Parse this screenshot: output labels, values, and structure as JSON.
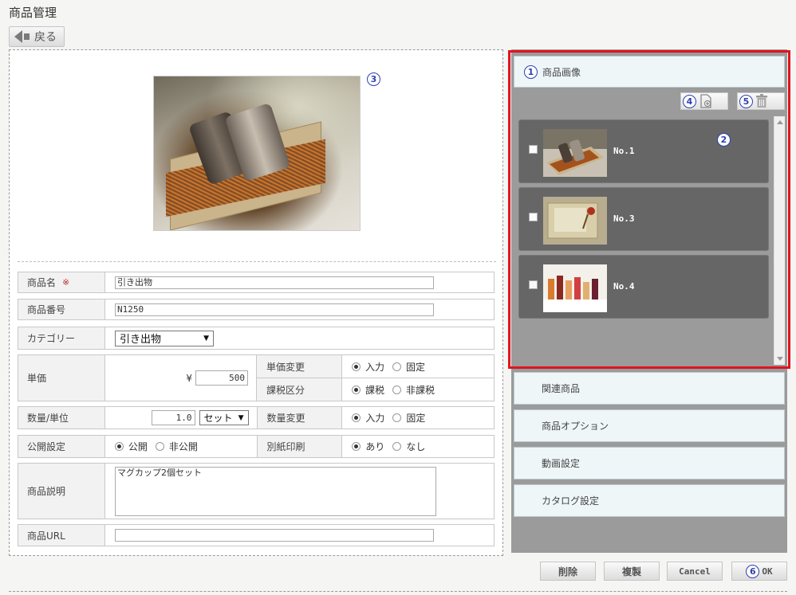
{
  "page": {
    "title": "商品管理",
    "back_label": "戻る"
  },
  "markers": {
    "m1": "1",
    "m2": "2",
    "m3": "3",
    "m4": "4",
    "m5": "5",
    "m6": "6"
  },
  "form": {
    "name_label": "商品名",
    "required_mark": "※",
    "name_value": "引き出物",
    "number_label": "商品番号",
    "number_value": "N1250",
    "category_label": "カテゴリー",
    "category_value": "引き出物",
    "price_label": "単価",
    "price_currency": "¥",
    "price_value": "500",
    "price_change_label": "単価変更",
    "price_change_options": [
      "入力",
      "固定"
    ],
    "tax_label": "課税区分",
    "tax_options": [
      "課税",
      "非課税"
    ],
    "qty_label": "数量/単位",
    "qty_value": "1.0",
    "unit_value": "セット",
    "qty_change_label": "数量変更",
    "qty_change_options": [
      "入力",
      "固定"
    ],
    "public_label": "公開設定",
    "public_options": [
      "公開",
      "非公開"
    ],
    "print_label": "別紙印刷",
    "print_options": [
      "あり",
      "なし"
    ],
    "desc_label": "商品説明",
    "desc_value": "マグカップ2個セット",
    "url_label": "商品URL",
    "url_value": ""
  },
  "right": {
    "image_section_title": "商品画像",
    "images": [
      {
        "label": "No.1"
      },
      {
        "label": "No.3"
      },
      {
        "label": "No.4"
      }
    ],
    "sections": [
      "関連商品",
      "商品オプション",
      "動画設定",
      "カタログ設定"
    ]
  },
  "buttons": {
    "delete": "削除",
    "copy": "複製",
    "cancel": "Cancel",
    "ok": "OK"
  },
  "colors": {
    "highlight_frame": "#e0141e",
    "marker": "#2f3fb0"
  }
}
